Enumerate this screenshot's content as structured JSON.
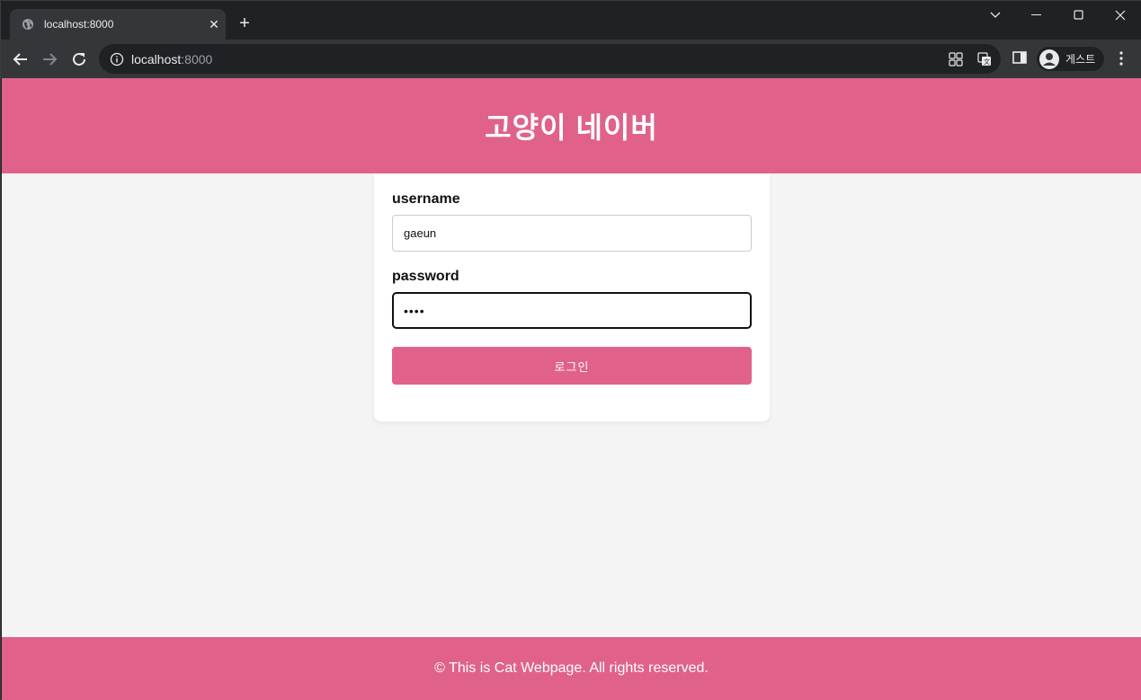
{
  "browser": {
    "tab": {
      "title": "localhost:8000",
      "close_glyph": "✕",
      "icon": "globe-icon"
    },
    "new_tab_glyph": "+",
    "address": {
      "host": "localhost",
      "port": ":8000"
    },
    "profile": {
      "label": "게스트",
      "icon": "avatar-icon"
    },
    "icons": [
      "back-icon",
      "forward-icon",
      "reload-icon",
      "info-icon",
      "apps-icon",
      "translate-icon",
      "side-panel-icon",
      "menu-icon",
      "minimize-icon",
      "maximize-icon",
      "close-icon",
      "tab-search-icon"
    ]
  },
  "page": {
    "header_title": "고양이 네이버",
    "form": {
      "username_label": "username",
      "username_value": "gaeun",
      "password_label": "password",
      "password_value": "••••",
      "submit_label": "로그인"
    },
    "footer_text": "© This is Cat Webpage. All rights reserved."
  },
  "colors": {
    "brand_pink": "#e0628a",
    "page_bg": "#f4f4f4",
    "chrome_dark": "#202124",
    "chrome_toolbar": "#35363a"
  }
}
